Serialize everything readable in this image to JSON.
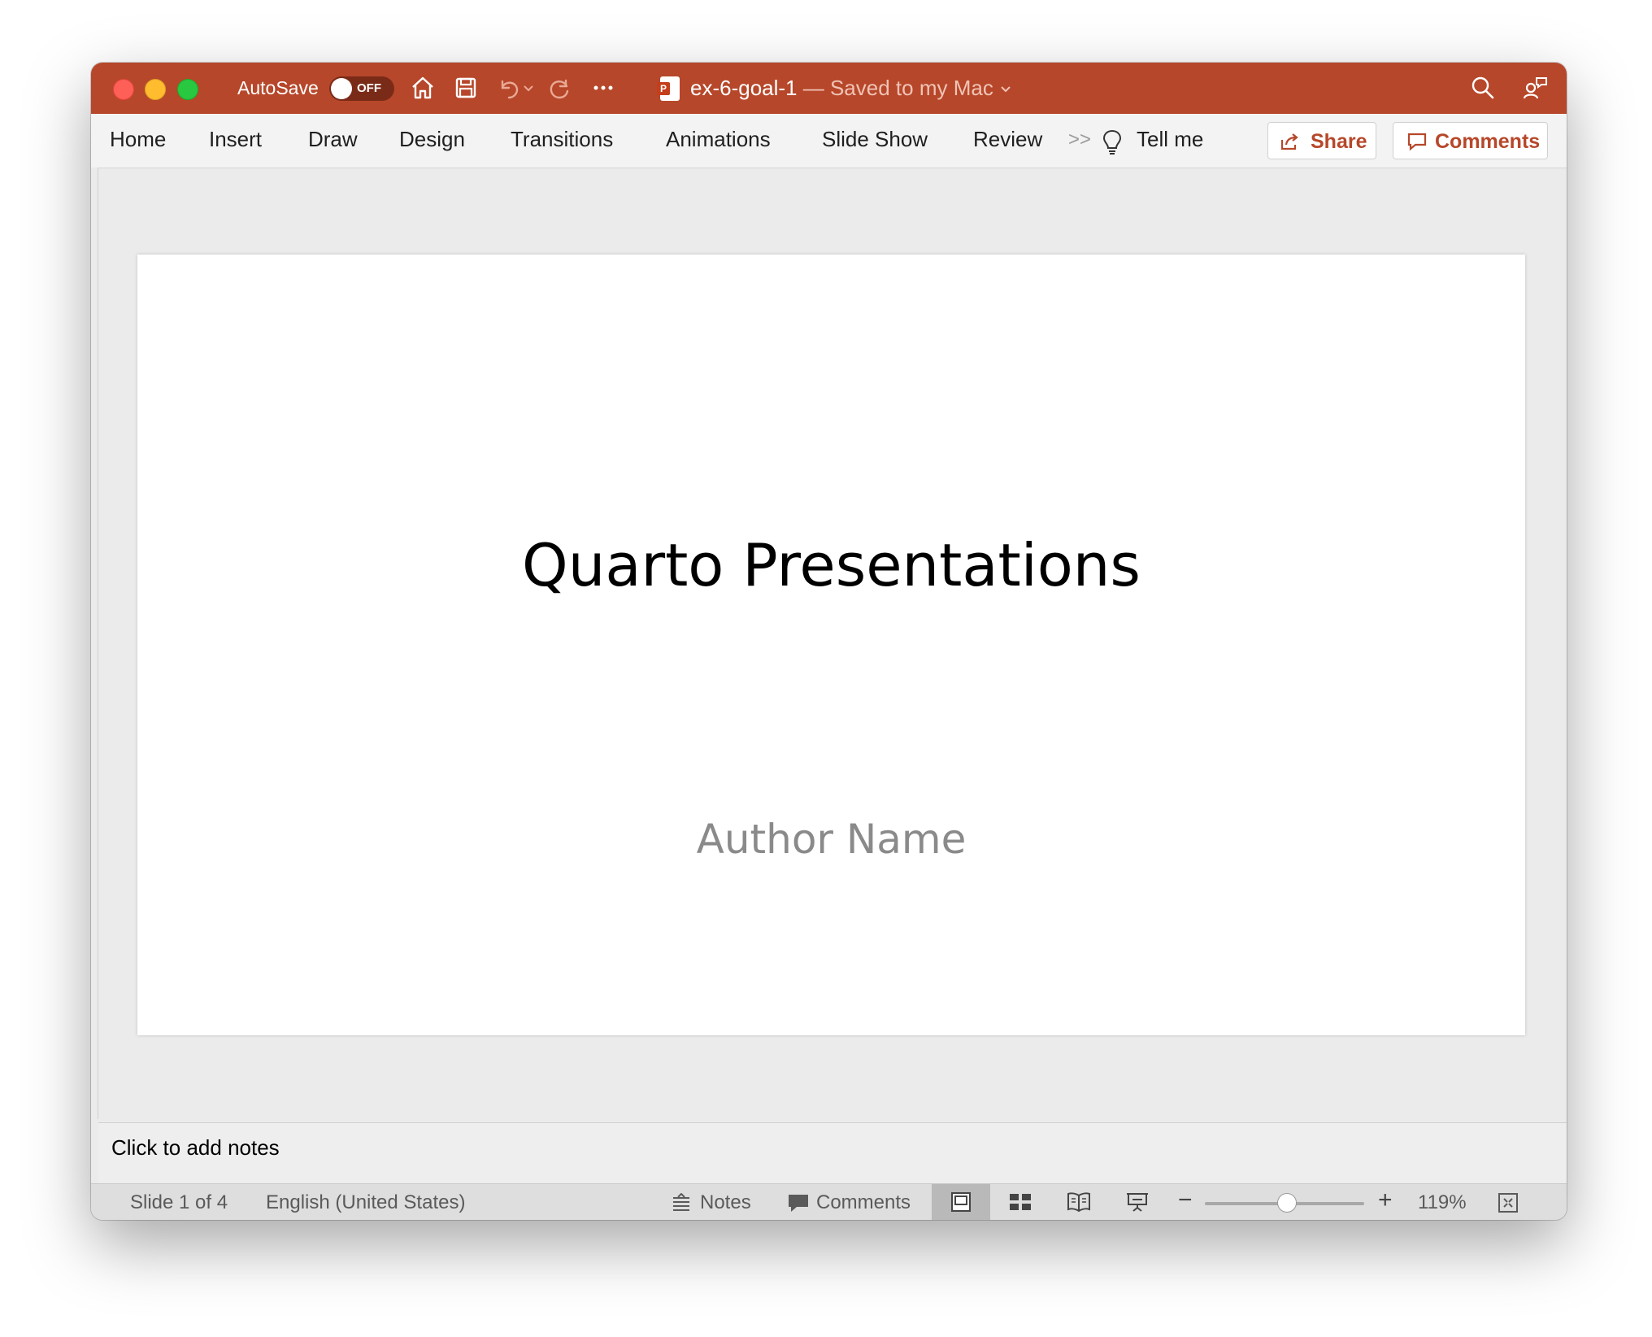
{
  "titlebar": {
    "autosave_label": "AutoSave",
    "autosave_state": "OFF",
    "doc_name": "ex-6-goal-1",
    "doc_status": " — Saved to my Mac"
  },
  "ribbon": {
    "tabs": [
      "Home",
      "Insert",
      "Draw",
      "Design",
      "Transitions",
      "Animations",
      "Slide Show",
      "Review"
    ],
    "tell_me": "Tell me",
    "share_label": "Share",
    "comments_label": "Comments"
  },
  "slide": {
    "title": "Quarto Presentations",
    "subtitle": "Author Name"
  },
  "notes": {
    "placeholder": "Click to add notes"
  },
  "statusbar": {
    "slide_indicator": "Slide 1 of 4",
    "language": "English (United States)",
    "notes_label": "Notes",
    "comments_label": "Comments",
    "zoom": "119%"
  },
  "colors": {
    "accent": "#b7472a"
  }
}
